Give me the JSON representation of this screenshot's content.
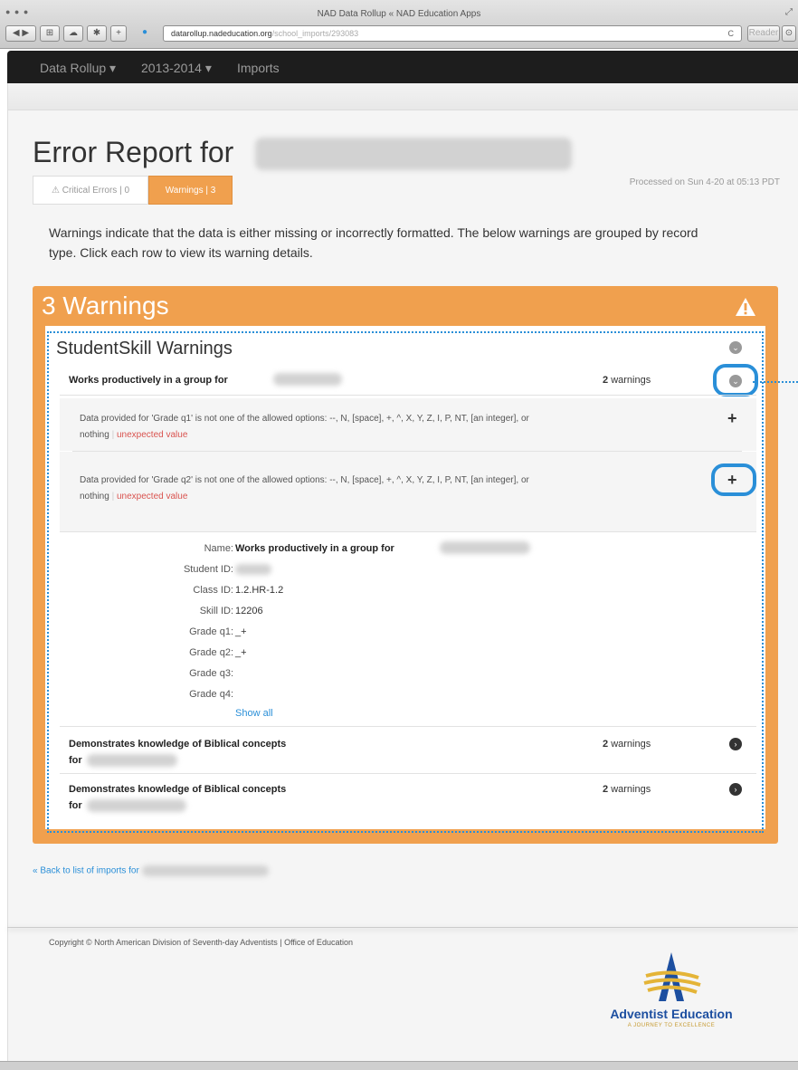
{
  "window": {
    "title": "NAD Data Rollup « NAD Education Apps",
    "url_host": "datarollup.nadeducation.org",
    "url_path": "/school_imports/293083",
    "reader_label": "Reader"
  },
  "navbar": {
    "items": [
      {
        "label": "Data Rollup ▾"
      },
      {
        "label": "2013-2014 ▾"
      },
      {
        "label": "Imports"
      }
    ]
  },
  "header": {
    "title": "Error Report for",
    "processed": "Processed on Sun 4-20 at 05:13 PDT"
  },
  "tabs": {
    "critical": "Critical Errors | 0",
    "warnings": "Warnings | 3"
  },
  "intro": "Warnings indicate that the data is either missing or incorrectly formatted. The below warnings are grouped by record type. Click each row to view its warning details.",
  "panel": {
    "title": "3 Warnings",
    "group_title": "StudentSkill Warnings",
    "rows": [
      {
        "title": "Works productively in a group for",
        "count": "2",
        "count_suffix": "warnings"
      },
      {
        "title": "Demonstrates knowledge of Biblical concepts",
        "title2": "for",
        "count": "2",
        "count_suffix": "warnings"
      },
      {
        "title": "Demonstrates knowledge of Biblical concepts",
        "title2": "for",
        "count": "2",
        "count_suffix": "warnings"
      }
    ],
    "warnings": [
      {
        "text": "Data provided for 'Grade q1' is not one of the allowed options: --, N, [space], +, ^, X, Y, Z, I, P, NT, [an integer], or",
        "text2": "nothing",
        "tag": "unexpected value"
      },
      {
        "text": "Data provided for 'Grade q2' is not one of the allowed options: --, N, [space], +, ^, X, Y, Z, I, P, NT, [an integer], or",
        "text2": "nothing",
        "tag": "unexpected value"
      }
    ],
    "details": [
      {
        "label": "Name:",
        "value": "Works productively in a group for"
      },
      {
        "label": "Student ID:",
        "value": ""
      },
      {
        "label": "Class ID:",
        "value": "1.2.HR-1.2"
      },
      {
        "label": "Skill ID:",
        "value": "12206"
      },
      {
        "label": "Grade q1:",
        "value": "_+"
      },
      {
        "label": "Grade q2:",
        "value": "_+"
      },
      {
        "label": "Grade q3:",
        "value": ""
      },
      {
        "label": "Grade q4:",
        "value": ""
      }
    ],
    "show_all": "Show all"
  },
  "back_link": "« Back to list of imports for",
  "footer": {
    "copyright": "Copyright © North American Division of Seventh-day Adventists | Office of Education",
    "logo_text": "Adventist Education",
    "logo_sub": "A JOURNEY TO EXCELLENCE"
  },
  "colors": {
    "accent": "#f0a04e",
    "link": "#2a8fd8",
    "error": "#d9534f",
    "navbar": "#1d1d1d"
  }
}
